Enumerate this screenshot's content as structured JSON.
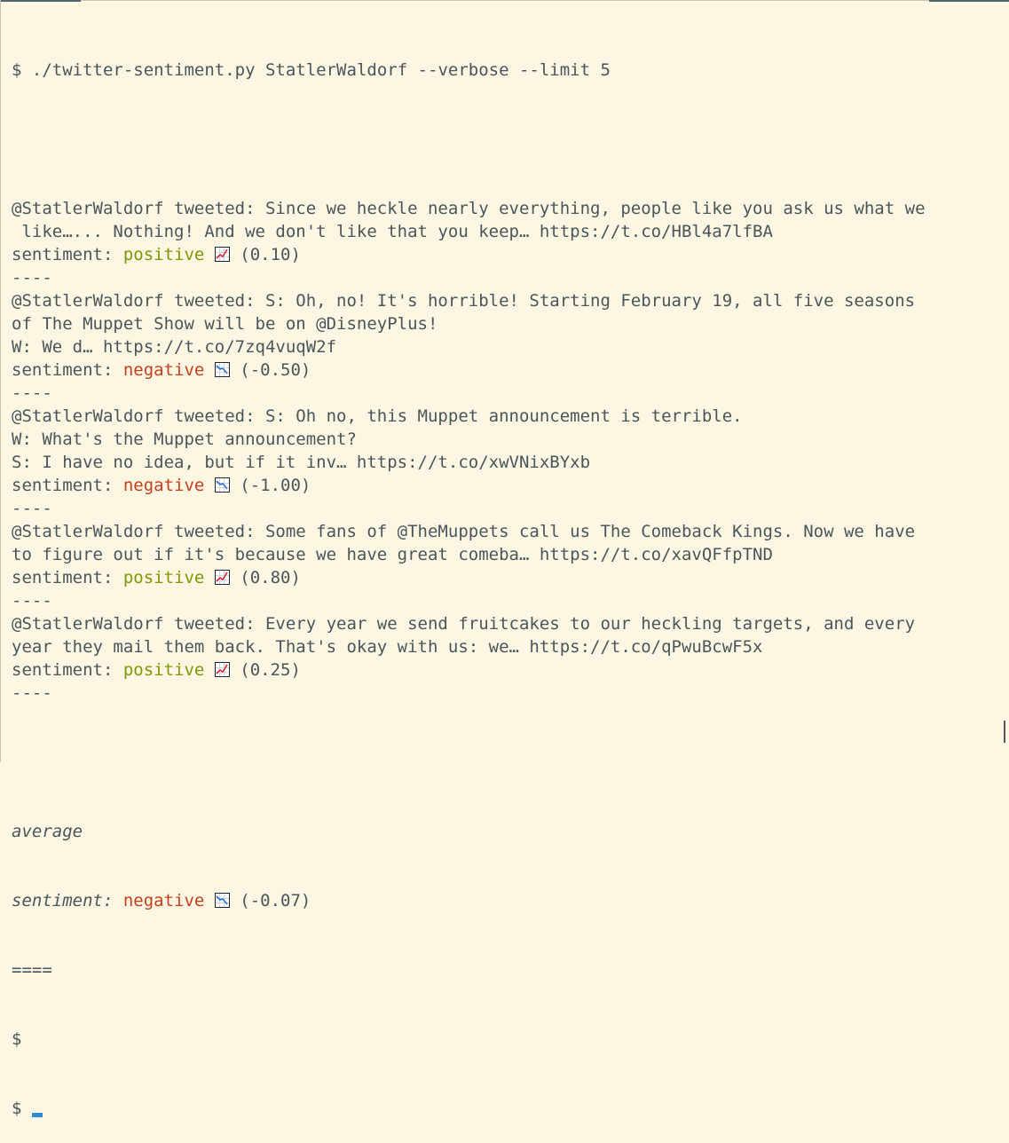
{
  "prompt": "$ ",
  "command": "./twitter-sentiment.py StatlerWaldorf --verbose --limit 5",
  "sentiment_label": "sentiment: ",
  "icons": {
    "up": "chart-increasing-icon",
    "down": "chart-decreasing-icon"
  },
  "colors": {
    "positive": "#7f9700",
    "negative": "#c4401d",
    "text": "#4a5659",
    "background": "#fdf6e3",
    "cursor": "#2f8ad8"
  },
  "tweets": [
    {
      "lines": [
        "@StatlerWaldorf tweeted: Since we heckle nearly everything, people like you ask us what we",
        " like…... Nothing! And we don't like that you keep… https://t.co/HBl4a7lfBA"
      ],
      "sentiment": "positive",
      "score": "(0.10)",
      "separator": "----"
    },
    {
      "lines": [
        "@StatlerWaldorf tweeted: S: Oh, no! It's horrible! Starting February 19, all five seasons",
        "of The Muppet Show will be on @DisneyPlus!",
        "W: We d… https://t.co/7zq4vuqW2f"
      ],
      "sentiment": "negative",
      "score": "(-0.50)",
      "separator": "----"
    },
    {
      "lines": [
        "@StatlerWaldorf tweeted: S: Oh no, this Muppet announcement is terrible.",
        "W: What's the Muppet announcement?",
        "S: I have no idea, but if it inv… https://t.co/xwVNixBYxb"
      ],
      "sentiment": "negative",
      "score": "(-1.00)",
      "separator": "----"
    },
    {
      "lines": [
        "@StatlerWaldorf tweeted: Some fans of @TheMuppets call us The Comeback Kings. Now we have",
        "to figure out if it's because we have great comeba… https://t.co/xavQFfpTND"
      ],
      "sentiment": "positive",
      "score": "(0.80)",
      "separator": "----"
    },
    {
      "lines": [
        "@StatlerWaldorf tweeted: Every year we send fruitcakes to our heckling targets, and every",
        "year they mail them back. That's okay with us: we… https://t.co/qPwuBcwF5x"
      ],
      "sentiment": "positive",
      "score": "(0.25)",
      "separator": "----"
    }
  ],
  "average": {
    "label": "average",
    "sentiment_label": "sentiment:",
    "sentiment": "negative",
    "score": "(-0.07)",
    "separator": "===="
  }
}
